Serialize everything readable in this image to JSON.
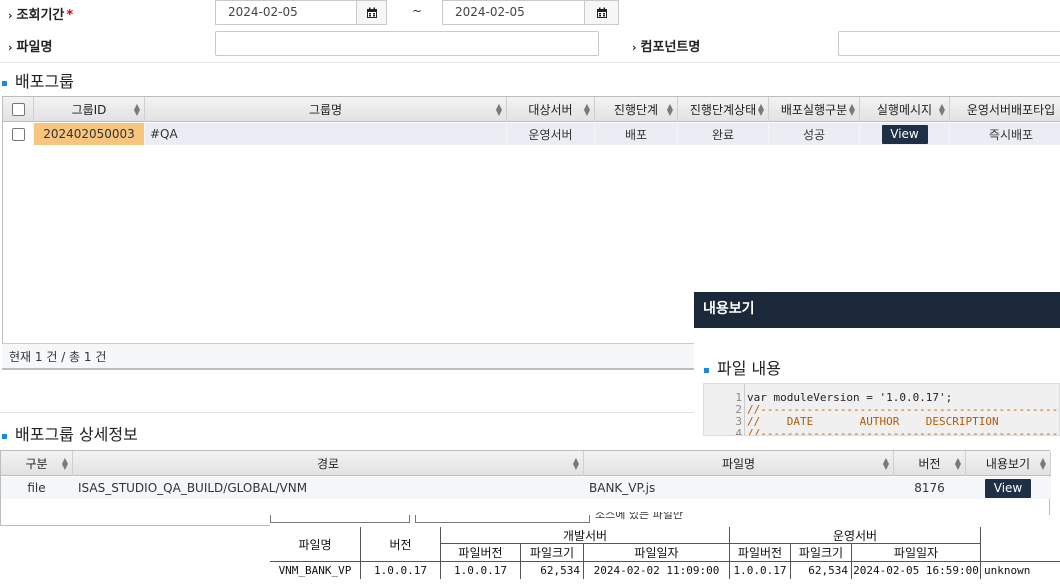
{
  "search": {
    "period_label": "조회기간",
    "required_mark": "*",
    "date_from": "2024-02-05",
    "date_to": "2024-02-05",
    "tilde": "~",
    "filename_label": "파일명",
    "component_label": "컴포넌트명"
  },
  "deploy_group": {
    "title": "배포그룹",
    "headers": [
      "그룹ID",
      "그룹명",
      "대상서버",
      "진행단계",
      "진행단계상태",
      "배포실행구분",
      "실행메시지",
      "운영서버배포타입"
    ],
    "row": {
      "group_id": "202402050003",
      "group_name": "#QA",
      "target_server": "운영서버",
      "stage": "배포",
      "stage_status": "완료",
      "exec_type": "성공",
      "message_button": "View",
      "deploy_type": "즉시배포"
    },
    "footer": "현재 1 건 / 총 1 건"
  },
  "detail": {
    "title": "배포그룹 상세정보",
    "headers": [
      "구분",
      "경로",
      "파일명",
      "버전",
      "내용보기"
    ],
    "row": {
      "type": "file",
      "path": "ISAS_STUDIO_QA_BUILD/GLOBAL/VNM",
      "filename": "BANK_VP.js",
      "version": "8176",
      "view_button": "View"
    }
  },
  "modal": {
    "title": "내용보기",
    "section_title": "파일 내용",
    "code_lines": [
      {
        "n": "1",
        "text": "var moduleVersion = '1.0.0.17';"
      },
      {
        "n": "2",
        "text": "//------------------------------------------------------------"
      },
      {
        "n": "3",
        "text": "//    DATE       AUTHOR    DESCRIPTION"
      },
      {
        "n": "4",
        "text": "//------------------------------------------------------------"
      }
    ]
  },
  "report": {
    "partial_text": "소스에 있는 파일만",
    "headers": {
      "filename": "파일명",
      "version": "버전",
      "dev_server": "개발서버",
      "prod_server": "운영서버",
      "file_version": "파일버전",
      "file_size": "파일크기",
      "file_date": "파일일자"
    },
    "row": {
      "filename": "VNM_BANK_VP",
      "version": "1.0.0.17",
      "dev_version": "1.0.0.17",
      "dev_size": "62,534",
      "dev_date": "2024-02-02 11:09:00",
      "prod_version": "1.0.0.17",
      "prod_size": "62,534",
      "prod_date": "2024-02-05 16:59:00",
      "extra": "unknown"
    }
  },
  "colors": {
    "accent": "#1c8ad7",
    "dark_button": "#1f2f45",
    "highlight": "#f8c57f",
    "row_selected": "#eaeef4",
    "modal_header": "#1b283a"
  }
}
